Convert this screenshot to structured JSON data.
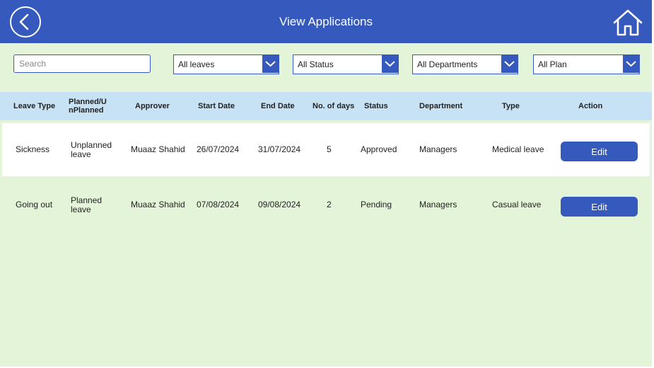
{
  "header": {
    "title": "View Applications",
    "back_icon": "chevron-left-circle-icon",
    "home_icon": "home-icon",
    "bg_color": "#3559bd"
  },
  "filters": {
    "search_placeholder": "Search",
    "leave_type": "All leaves",
    "status": "All Status",
    "department": "All Departments",
    "plan": "All Plan"
  },
  "table": {
    "columns": [
      "Leave Type",
      "Planned/U nPlanned",
      "Approver",
      "Start Date",
      "End Date",
      "No. of days",
      "Status",
      "Department",
      "Type",
      "Action"
    ],
    "rows": [
      {
        "leave_type": "Sickness",
        "planned": "Unplanned leave",
        "approver": "Muaaz Shahid",
        "start_date": "26/07/2024",
        "end_date": "31/07/2024",
        "days": "5",
        "status": "Approved",
        "department": "Managers",
        "type": "Medical leave",
        "action": "Edit"
      },
      {
        "leave_type": "Going out",
        "planned": "Planned leave",
        "approver": "Muaaz Shahid",
        "start_date": "07/08/2024",
        "end_date": "09/08/2024",
        "days": "2",
        "status": "Pending",
        "department": "Managers",
        "type": "Casual leave",
        "action": "Edit"
      }
    ]
  },
  "colors": {
    "accent": "#3559bd",
    "background": "#e4f4d8",
    "table_header": "#c6e2f4"
  }
}
